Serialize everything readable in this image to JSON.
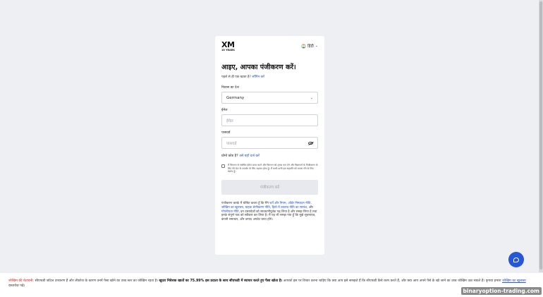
{
  "brand": {
    "logo_text": "XM",
    "logo_sub": "15 YEARS"
  },
  "language": {
    "label": "हिंदी",
    "flag_icon": "india-flag-icon"
  },
  "form": {
    "title": "आइए, आपका पंजीकरण करें।",
    "have_account_text": "पहले से ही एक खाता है?",
    "login_link": "लॉगिन करें",
    "country_label": "निवास का देश",
    "country_value": "Germany",
    "email_label": "ईमेल",
    "email_placeholder": "ईमेल",
    "password_label": "पासवर्ड",
    "password_placeholder": "पासवर्ड",
    "promo_question": "प्रोमो कोड है?",
    "promo_link": "उसे यहाँ दर्ज करें",
    "consent_text": "मैं विपणन से संबंधित ईमेल प्राप्त करने और विपणन को तृतक रूप देने और विज्ञापनों के निजीकरण के लिए मेरे डेटा के उपयोग के लिए सहमत होता हूँ। मैं कभी-कभी इस सहमति को वापस लेने के लिए स्वतंत्र हूँ।",
    "submit_label": "पंजीकरण करें",
    "legal_prefix": "पंजीकरण करके मैं घोषित करता हूँ कि मैंने",
    "legal_links": [
      "शर्तें और नियम",
      "ऑर्डर निष्पादन नीति",
      "जोखिम का खुलासा",
      "ग्राहक श्रेणीकरण नीति",
      "हितों में टकराव नीति का सारांश",
      "गोपनीयता नीति"
    ],
    "legal_suffix": "इन दस्तावेज़ों को सावधानीपूर्वक पढ़ लिया है और समझ लिया है तथा इनके संपूर्ण पाठ को स्वीकार कर लिया है। मैं यह भी समझ गया हूँ कि मुझे सूचनापत्र, कंपनी समाचार, और उत्पाद अपडेट प्राप्त होंगे।"
  },
  "footer": {
    "warning_label": "जोखिम की चेतावनी:",
    "text_1": "सीएफडी जटिल उपकरण हैं और लीवरेज के कारण उनमें पैसा खोने का उच्च स्तर का जोखिम रहता है।",
    "bold_text": "खुदरा निवेशक खातों का 75.99% इस प्रदाता के साथ सीएफडी में व्यापार करते हुए पैसा खोता है।",
    "text_2": "आपको इस पर विचार करना चाहिए कि क्या आप इसे समझते हैं कि सीएफडी कैसे काम करते हैं, और क्या आप अपने पैसे के खो जाने का उच्च जोखिम उठा सकते हैं। कृपया हमारा",
    "link": "जोखिम का खुलासा",
    "text_3": "दस्तावेज़ पढ़ें।"
  },
  "watermark": "binaryoption-trading.com",
  "colors": {
    "accent": "#2657d4",
    "link": "#2e5bc7",
    "warning": "#d4342b"
  }
}
